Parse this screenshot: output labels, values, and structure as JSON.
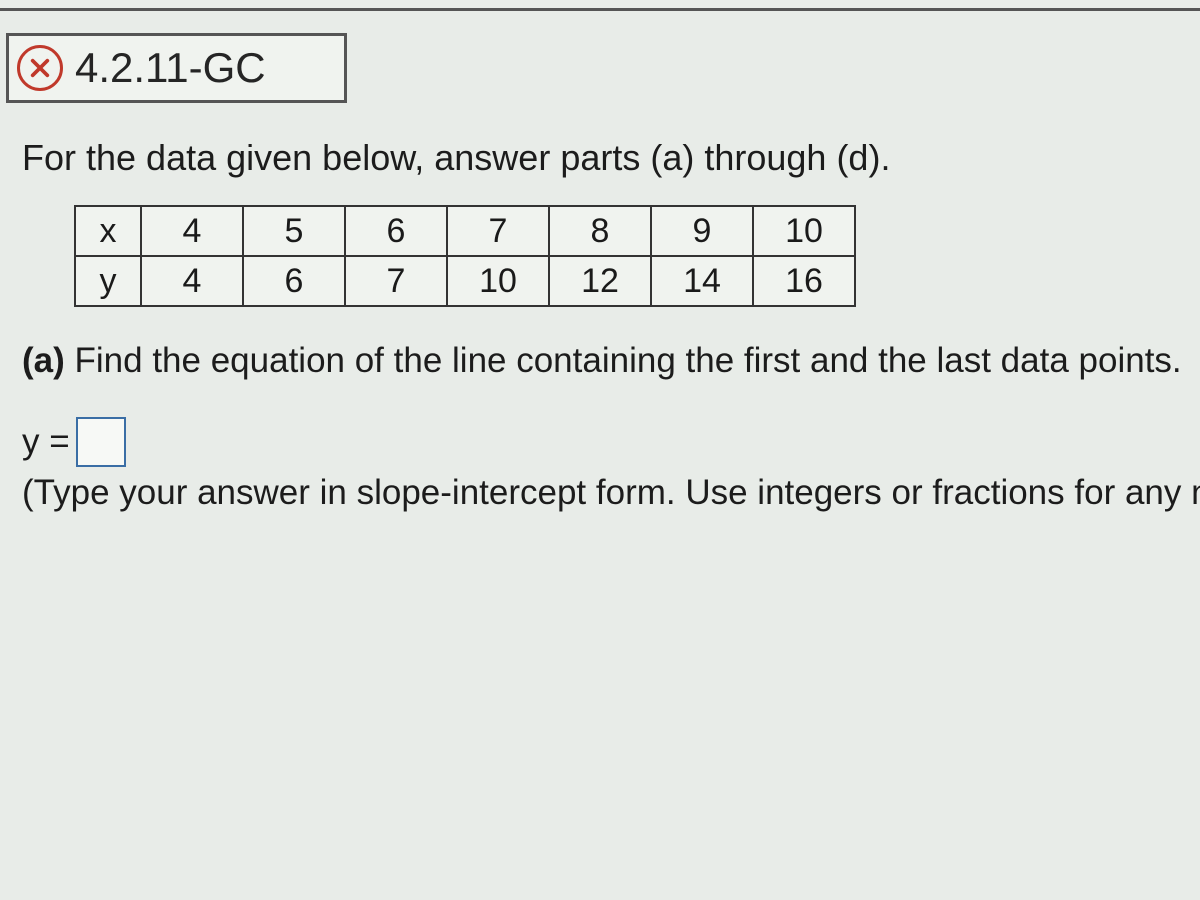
{
  "top_fragment": "",
  "status_icon": "x-incorrect-icon",
  "problem_number": "4.2.11-GC",
  "instruction": "For the data given below, answer parts (a) through (d).",
  "chart_data": {
    "type": "table",
    "rows": [
      {
        "label": "x",
        "values": [
          "4",
          "5",
          "6",
          "7",
          "8",
          "9",
          "10"
        ]
      },
      {
        "label": "y",
        "values": [
          "4",
          "6",
          "7",
          "10",
          "12",
          "14",
          "16"
        ]
      }
    ]
  },
  "part_a": {
    "label": "(a)",
    "text": "Find the equation of the line containing the first and the last data points."
  },
  "answer": {
    "prefix": "y =",
    "value": ""
  },
  "hint": "(Type your answer in slope-intercept form. Use integers or fractions for any num"
}
